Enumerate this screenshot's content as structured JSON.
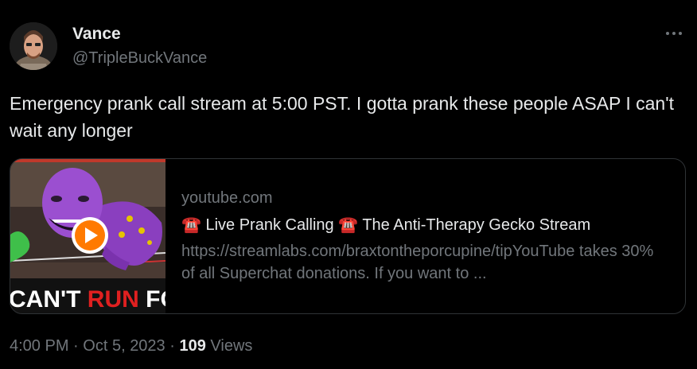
{
  "user": {
    "display_name": "Vance",
    "handle": "@TripleBuckVance"
  },
  "tweet": {
    "text": "Emergency prank call stream at 5:00 PST. I gotta prank these people ASAP I can't wait any longer"
  },
  "card": {
    "domain": "youtube.com",
    "title_icon": "☎️",
    "title_part1": " Live Prank Calling ",
    "title_part2": " The Anti-Therapy Gecko Stream",
    "description": "https://streamlabs.com/braxtontheporcupine/tipYouTube takes 30% of all Superchat donations. If you want to ...",
    "thumbnail_caption_white_1": "CAN'T ",
    "thumbnail_caption_red": "RUN",
    "thumbnail_caption_white_2": " FOR"
  },
  "meta": {
    "time": "4:00 PM",
    "separator": "·",
    "date": "Oct 5, 2023",
    "views_count": "109",
    "views_label": "Views"
  },
  "colors": {
    "background": "#000000",
    "text_primary": "#e7e9ea",
    "text_secondary": "#71767b",
    "border": "#2f3336",
    "play_button": "#ff7a00"
  },
  "icons": {
    "more": "more-horizontal-icon",
    "play": "play-icon",
    "phone": "telephone-icon"
  }
}
